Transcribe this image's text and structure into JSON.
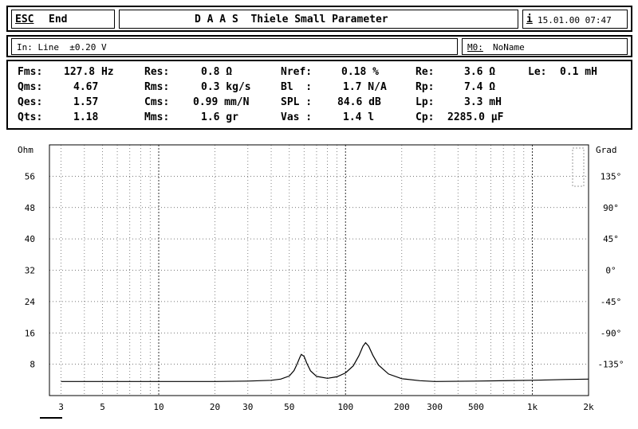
{
  "header": {
    "esc_key": "ESC",
    "end_label": "End",
    "title": "D A A S  Thiele Small Parameter",
    "info_key": "i",
    "datetime": "15.01.00 07:47"
  },
  "inputbar": {
    "input_label": "In: Line  ±0.20 V",
    "memory_key": "M0:",
    "memory_name": "NoName"
  },
  "params": {
    "col1": [
      {
        "label": "Fms:",
        "value": "127.8 Hz"
      },
      {
        "label": "Qms:",
        "value": "4.67"
      },
      {
        "label": "Qes:",
        "value": "1.57"
      },
      {
        "label": "Qts:",
        "value": "1.18"
      }
    ],
    "col2": [
      {
        "label": "Res:",
        "value": "0.8 Ω"
      },
      {
        "label": "Rms:",
        "value": "0.3 kg/s"
      },
      {
        "label": "Cms:",
        "value": "0.99 mm/N"
      },
      {
        "label": "Mms:",
        "value": "1.6 gr"
      }
    ],
    "col3": [
      {
        "label": "Nref:",
        "value": "0.18 %"
      },
      {
        "label": "Bl  :",
        "value": "1.7 N/A"
      },
      {
        "label": "SPL :",
        "value": "84.6 dB"
      },
      {
        "label": "Vas :",
        "value": "1.4 l"
      }
    ],
    "col4": [
      {
        "label": "Re:",
        "value": "3.6 Ω"
      },
      {
        "label": "Rp:",
        "value": "7.4 Ω"
      },
      {
        "label": "Lp:",
        "value": "3.3 mH"
      },
      {
        "label": "Cp:",
        "value": "2285.0 µF"
      }
    ],
    "le": {
      "label": "Le:",
      "value": "0.1 mH"
    }
  },
  "chart_data": {
    "type": "line",
    "xscale": "log",
    "xlim": [
      2.6,
      2000
    ],
    "x_ticks": [
      {
        "v": 3,
        "label": "3"
      },
      {
        "v": 5,
        "label": "5"
      },
      {
        "v": 10,
        "label": "10"
      },
      {
        "v": 20,
        "label": "20"
      },
      {
        "v": 30,
        "label": "30"
      },
      {
        "v": 50,
        "label": "50"
      },
      {
        "v": 100,
        "label": "100"
      },
      {
        "v": 200,
        "label": "200"
      },
      {
        "v": 300,
        "label": "300"
      },
      {
        "v": 500,
        "label": "500"
      },
      {
        "v": 1000,
        "label": "1k"
      },
      {
        "v": 2000,
        "label": "2k"
      }
    ],
    "ylabel_left": "Ohm",
    "ylim_left": [
      0,
      64
    ],
    "y_ticks_left": [
      8,
      16,
      24,
      32,
      40,
      48,
      56
    ],
    "ylabel_right": "Grad",
    "ylim_right": [
      -180,
      180
    ],
    "y_ticks_right": [
      {
        "v": 135,
        "label": "135°"
      },
      {
        "v": 90,
        "label": "90°"
      },
      {
        "v": 45,
        "label": "45°"
      },
      {
        "v": 0,
        "label": "0°"
      },
      {
        "v": -45,
        "label": "-45°"
      },
      {
        "v": -90,
        "label": "-90°"
      },
      {
        "v": -135,
        "label": "-135°"
      }
    ],
    "grid": true,
    "series": [
      {
        "x": [
          3,
          10,
          20,
          30,
          40,
          45,
          50,
          53,
          55,
          57,
          58,
          60,
          62,
          65,
          70,
          80,
          90,
          100,
          110,
          118,
          124,
          128,
          133,
          140,
          150,
          170,
          200,
          250,
          300
        ],
        "y": [
          3.6,
          3.6,
          3.6,
          3.7,
          3.9,
          4.2,
          5.0,
          6.4,
          8.0,
          9.8,
          10.5,
          10.0,
          8.3,
          6.3,
          4.9,
          4.4,
          4.8,
          5.8,
          7.6,
          10.2,
          12.6,
          13.5,
          12.6,
          10.3,
          7.8,
          5.5,
          4.3,
          3.8,
          3.6
        ]
      },
      {
        "x": [
          300,
          500,
          1000,
          1500,
          2000
        ],
        "y": [
          3.6,
          3.7,
          3.9,
          4.1,
          4.2
        ]
      }
    ]
  }
}
